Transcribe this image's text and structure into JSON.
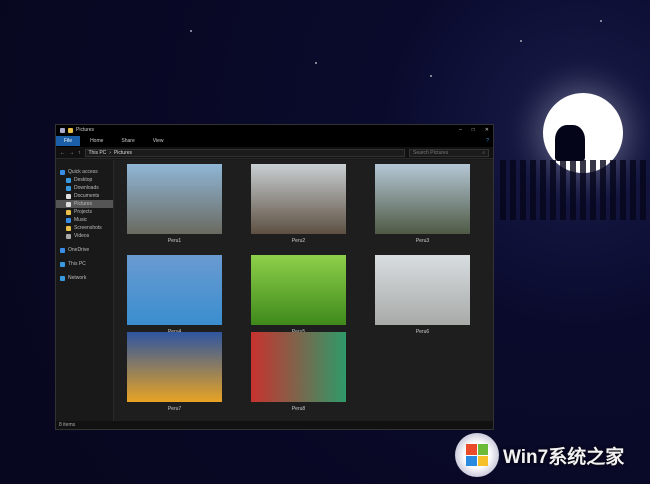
{
  "window": {
    "title": "Pictures",
    "tabs": [
      "File",
      "Home",
      "Share",
      "View"
    ],
    "path": [
      "This PC",
      "Pictures"
    ],
    "search_placeholder": "Search Pictures",
    "status": "8 items"
  },
  "sidebar": {
    "items": [
      {
        "label": "Quick access",
        "level": 0,
        "color": "#3a8ee6"
      },
      {
        "label": "Desktop",
        "level": 1,
        "color": "#3a9ae0"
      },
      {
        "label": "Downloads",
        "level": 1,
        "color": "#3a9ae0"
      },
      {
        "label": "Documents",
        "level": 1,
        "color": "#ddd"
      },
      {
        "label": "Pictures",
        "level": 1,
        "color": "#ddd",
        "selected": true
      },
      {
        "label": "Projects",
        "level": 1,
        "color": "#e8c04a"
      },
      {
        "label": "Music",
        "level": 1,
        "color": "#3a8ee6"
      },
      {
        "label": "Screenshots",
        "level": 1,
        "color": "#e8c04a"
      },
      {
        "label": "Videos",
        "level": 1,
        "color": "#aaa"
      },
      {
        "label": "OneDrive",
        "level": 0,
        "color": "#3a8ee6"
      },
      {
        "label": "This PC",
        "level": 0,
        "color": "#3a9ae0"
      },
      {
        "label": "Network",
        "level": 0,
        "color": "#3a9ae0"
      }
    ]
  },
  "files": [
    {
      "name": "Peru1",
      "colors": [
        "#8fb6d6",
        "#6a6a60"
      ]
    },
    {
      "name": "Peru2",
      "colors": [
        "#c9cfd2",
        "#5d5042"
      ]
    },
    {
      "name": "Peru3",
      "colors": [
        "#b5c7d6",
        "#4e5a44"
      ]
    },
    {
      "name": "Peru4",
      "colors": [
        "#6a9ad0",
        "#3a8ecf"
      ]
    },
    {
      "name": "Peru5",
      "colors": [
        "#8ed04a",
        "#3f8a1c"
      ]
    },
    {
      "name": "Peru6",
      "colors": [
        "#d8dde0",
        "#a8aaa8"
      ]
    },
    {
      "name": "Peru7",
      "colors": [
        "#2e55a0",
        "#e8a323"
      ]
    },
    {
      "name": "Peru8",
      "colors": [
        "#c9322e",
        "#2e9a6a"
      ]
    }
  ],
  "watermark": {
    "text": "Win7系统之家"
  }
}
